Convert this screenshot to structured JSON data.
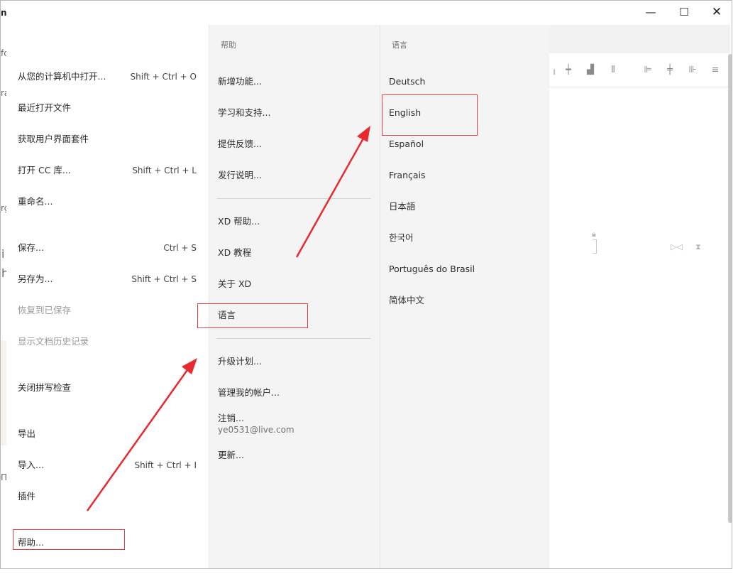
{
  "window": {
    "title_fragment": "n",
    "minimize_glyph": "—",
    "maximize_glyph": "☐",
    "close_glyph": "✕"
  },
  "background_fragments": [
    "fc",
    "ra",
    "rg",
    "i",
    "h",
    "/",
    "ct",
    "e",
    "Π"
  ],
  "file_menu": {
    "items": [
      {
        "label": "从您的计算机中打开...",
        "shortcut": "Shift + Ctrl + O",
        "enabled": true
      },
      {
        "label": "最近打开文件",
        "shortcut": "",
        "enabled": true
      },
      {
        "label": "获取用户界面套件",
        "shortcut": "",
        "enabled": true
      },
      {
        "label": "打开 CC 库...",
        "shortcut": "Shift + Ctrl + L",
        "enabled": true
      },
      {
        "label": "重命名...",
        "shortcut": "",
        "enabled": true
      },
      {
        "label": "保存...",
        "shortcut": "Ctrl + S",
        "enabled": true
      },
      {
        "label": "另存为...",
        "shortcut": "Shift + Ctrl + S",
        "enabled": true
      },
      {
        "label": "恢复到已保存",
        "shortcut": "",
        "enabled": false
      },
      {
        "label": "显示文档历史记录",
        "shortcut": "",
        "enabled": false
      },
      {
        "label": "关闭拼写检查",
        "shortcut": "",
        "enabled": true
      },
      {
        "label": "导出",
        "shortcut": "",
        "enabled": true
      },
      {
        "label": "导入...",
        "shortcut": "Shift + Ctrl + I",
        "enabled": true
      },
      {
        "label": "插件",
        "shortcut": "",
        "enabled": true
      },
      {
        "label": "帮助...",
        "shortcut": "",
        "enabled": true
      }
    ]
  },
  "help_menu": {
    "heading": "帮助",
    "items": [
      {
        "label": "新增功能..."
      },
      {
        "label": "学习和支持..."
      },
      {
        "label": "提供反馈..."
      },
      {
        "label": "发行说明..."
      },
      {
        "label": "XD 帮助..."
      },
      {
        "label": "XD 教程"
      },
      {
        "label": "关于 XD"
      },
      {
        "label": "语言"
      },
      {
        "label": "升级计划..."
      },
      {
        "label": "管理我的帐户..."
      },
      {
        "label": "注销...",
        "sublabel": "ye0531@live.com"
      },
      {
        "label": "更新..."
      }
    ]
  },
  "language_menu": {
    "heading": "语言",
    "items": [
      {
        "label": "Deutsch"
      },
      {
        "label": "English"
      },
      {
        "label": "Español"
      },
      {
        "label": "Français"
      },
      {
        "label": "日本語"
      },
      {
        "label": "한국어"
      },
      {
        "label": "Português do Brasil"
      },
      {
        "label": "简体中文"
      }
    ]
  },
  "annotations": {
    "highlight_color": "#e04040",
    "arrow_color": "#e8292e"
  },
  "colors": {
    "menu_bg": "#ffffff",
    "submenu_bg": "#f4f4f4",
    "disabled_text": "#9a9a9a"
  }
}
